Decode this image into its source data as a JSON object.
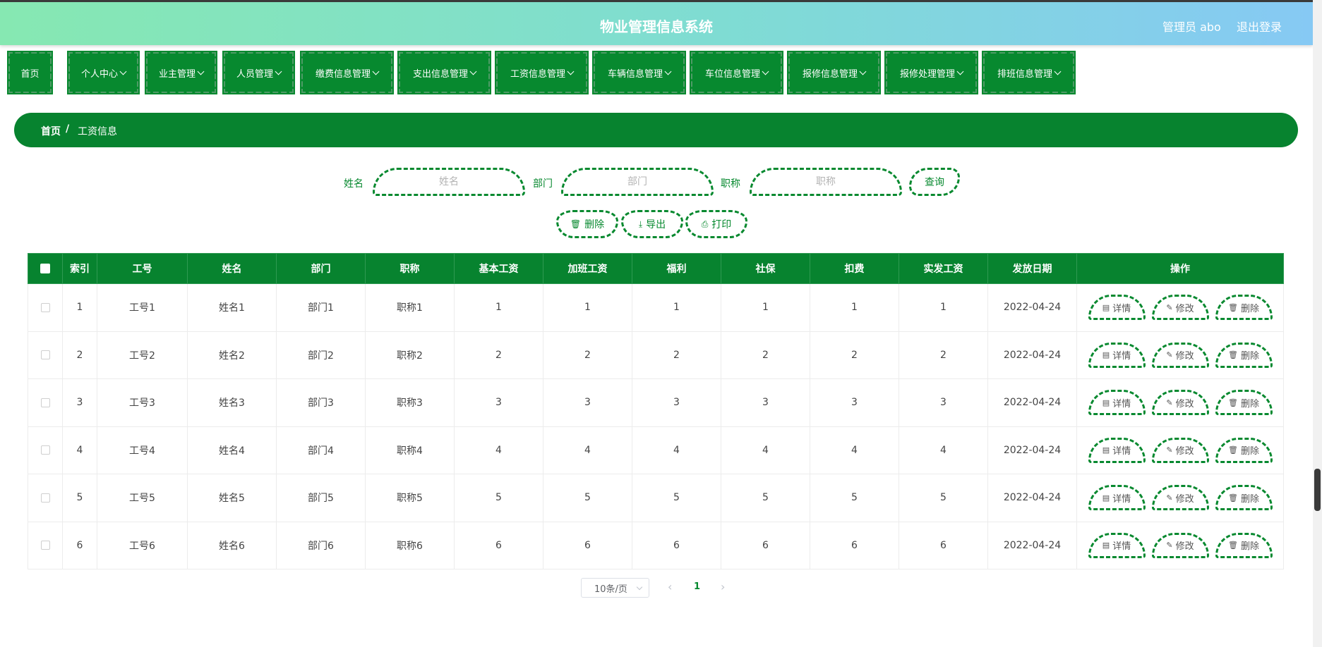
{
  "header": {
    "title": "物业管理信息系统",
    "admin": "管理员 abo",
    "logout": "退出登录"
  },
  "nav": [
    {
      "label": "首页",
      "dropdown": false
    },
    {
      "label": "个人中心",
      "dropdown": true
    },
    {
      "label": "业主管理",
      "dropdown": true
    },
    {
      "label": "人员管理",
      "dropdown": true
    },
    {
      "label": "缴费信息管理",
      "dropdown": true
    },
    {
      "label": "支出信息管理",
      "dropdown": true
    },
    {
      "label": "工资信息管理",
      "dropdown": true
    },
    {
      "label": "车辆信息管理",
      "dropdown": true
    },
    {
      "label": "车位信息管理",
      "dropdown": true
    },
    {
      "label": "报修信息管理",
      "dropdown": true
    },
    {
      "label": "报修处理管理",
      "dropdown": true
    },
    {
      "label": "排班信息管理",
      "dropdown": true
    }
  ],
  "breadcrumb": {
    "home": "首页",
    "sep": "/",
    "current": "工资信息"
  },
  "search": {
    "name_label": "姓名",
    "name_placeholder": "姓名",
    "dept_label": "部门",
    "dept_placeholder": "部门",
    "title_label": "职称",
    "title_placeholder": "职称",
    "query": "查询"
  },
  "actions": {
    "delete": "删除",
    "export": "导出",
    "print": "打印"
  },
  "table": {
    "headers": [
      "索引",
      "工号",
      "姓名",
      "部门",
      "职称",
      "基本工资",
      "加班工资",
      "福利",
      "社保",
      "扣费",
      "实发工资",
      "发放日期",
      "操作"
    ],
    "rows": [
      [
        "1",
        "工号1",
        "姓名1",
        "部门1",
        "职称1",
        "1",
        "1",
        "1",
        "1",
        "1",
        "1",
        "2022-04-24"
      ],
      [
        "2",
        "工号2",
        "姓名2",
        "部门2",
        "职称2",
        "2",
        "2",
        "2",
        "2",
        "2",
        "2",
        "2022-04-24"
      ],
      [
        "3",
        "工号3",
        "姓名3",
        "部门3",
        "职称3",
        "3",
        "3",
        "3",
        "3",
        "3",
        "3",
        "2022-04-24"
      ],
      [
        "4",
        "工号4",
        "姓名4",
        "部门4",
        "职称4",
        "4",
        "4",
        "4",
        "4",
        "4",
        "4",
        "2022-04-24"
      ],
      [
        "5",
        "工号5",
        "姓名5",
        "部门5",
        "职称5",
        "5",
        "5",
        "5",
        "5",
        "5",
        "5",
        "2022-04-24"
      ],
      [
        "6",
        "工号6",
        "姓名6",
        "部门6",
        "职称6",
        "6",
        "6",
        "6",
        "6",
        "6",
        "6",
        "2022-04-24"
      ]
    ],
    "row_actions": {
      "detail": "详情",
      "edit": "修改",
      "delete": "删除"
    }
  },
  "pagination": {
    "page_size": "10条/页",
    "current_page": "1",
    "prev": "‹",
    "next": "›"
  },
  "colors": {
    "primary": "#07892f",
    "header_start": "#86e8b2",
    "header_end": "#86c9f4"
  },
  "icons": {
    "delete": "trash-icon",
    "export": "download-icon",
    "print": "printer-icon",
    "detail": "document-icon",
    "edit": "pencil-icon"
  }
}
